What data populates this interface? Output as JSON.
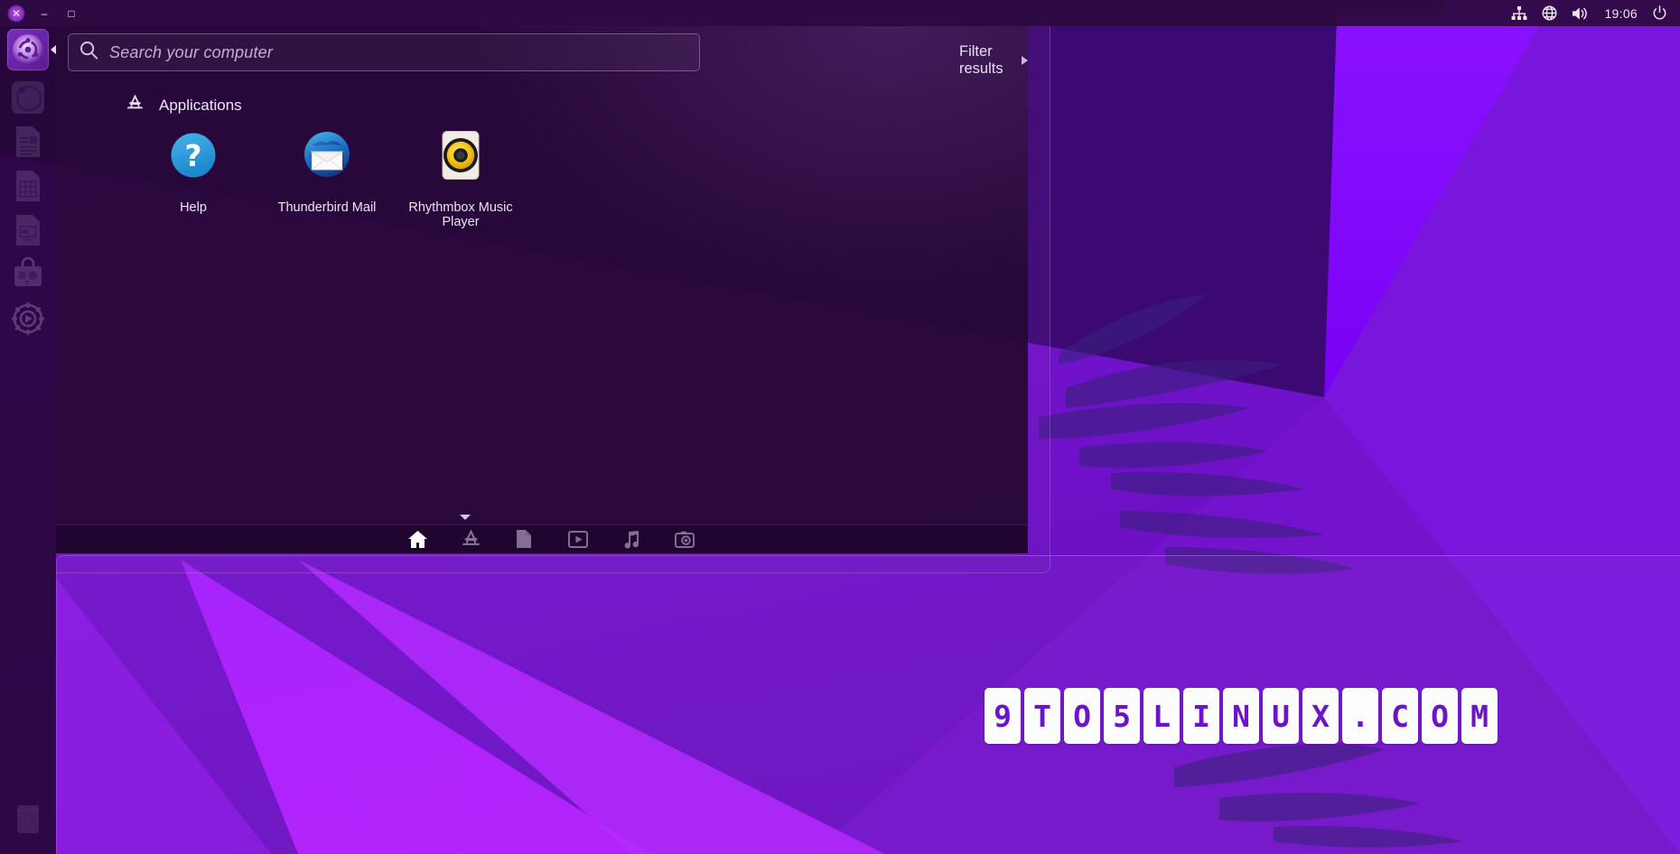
{
  "top_panel": {
    "window_controls": [
      {
        "name": "close",
        "glyph": "✕"
      },
      {
        "name": "minimize",
        "glyph": "–"
      },
      {
        "name": "maximize",
        "glyph": "□"
      }
    ],
    "indicators": [
      {
        "name": "network-icon",
        "label": "Network"
      },
      {
        "name": "language-icon",
        "label": "Language"
      },
      {
        "name": "volume-icon",
        "label": "Volume"
      }
    ],
    "clock": "19:06",
    "session_icon": "power-icon"
  },
  "launcher": {
    "items": [
      {
        "name": "ubuntu-dash",
        "label": "Dash home",
        "active": true
      },
      {
        "name": "firefox",
        "label": "Firefox Web Browser",
        "active": false
      },
      {
        "name": "libreoffice-writer",
        "label": "LibreOffice Writer",
        "active": false
      },
      {
        "name": "libreoffice-calc",
        "label": "LibreOffice Calc",
        "active": false
      },
      {
        "name": "libreoffice-impress",
        "label": "LibreOffice Impress",
        "active": false
      },
      {
        "name": "software-center",
        "label": "Ubuntu Software",
        "active": false
      },
      {
        "name": "system-settings",
        "label": "System Settings",
        "active": false
      },
      {
        "name": "trash",
        "label": "Trash",
        "active": false
      }
    ]
  },
  "dash": {
    "search": {
      "placeholder": "Search your computer",
      "value": "",
      "icon": "search-icon"
    },
    "filter": {
      "label": "Filter results",
      "icon": "triangle-right-icon"
    },
    "category": {
      "label": "Applications",
      "icon": "applications-icon"
    },
    "applications": [
      {
        "name": "help",
        "label": "Help",
        "icon": "help-icon"
      },
      {
        "name": "thunderbird-mail",
        "label": "Thunderbird Mail",
        "icon": "thunderbird-icon"
      },
      {
        "name": "rhythmbox-music-player",
        "label": "Rhythmbox Music Player",
        "icon": "rhythmbox-icon"
      }
    ],
    "lenses": [
      {
        "name": "lens-home",
        "label": "Home",
        "icon": "home-icon",
        "active": true
      },
      {
        "name": "lens-applications",
        "label": "Applications",
        "icon": "applications-icon",
        "active": false
      },
      {
        "name": "lens-files",
        "label": "Files & Folders",
        "icon": "document-icon",
        "active": false
      },
      {
        "name": "lens-video",
        "label": "Video",
        "icon": "video-icon",
        "active": false
      },
      {
        "name": "lens-music",
        "label": "Music",
        "icon": "music-note-icon",
        "active": false
      },
      {
        "name": "lens-photos",
        "label": "Photos",
        "icon": "camera-icon",
        "active": false
      }
    ]
  },
  "watermark": {
    "text": "9TO5LINUX.COM",
    "characters": [
      "9",
      "T",
      "O",
      "5",
      "L",
      "I",
      "N",
      "U",
      "X",
      ".",
      "C",
      "O",
      "M"
    ]
  },
  "colors": {
    "accent_purple": "#7b2bbd",
    "dash_bg": "#260836",
    "wallpaper_base": "#6a10c8",
    "wallpaper_bright": "#7b00ff",
    "wallpaper_dark": "#3a0b66",
    "text_primary": "#efe6f5",
    "text_muted": "#c3afd2",
    "watermark_text": "#6b14c9"
  }
}
